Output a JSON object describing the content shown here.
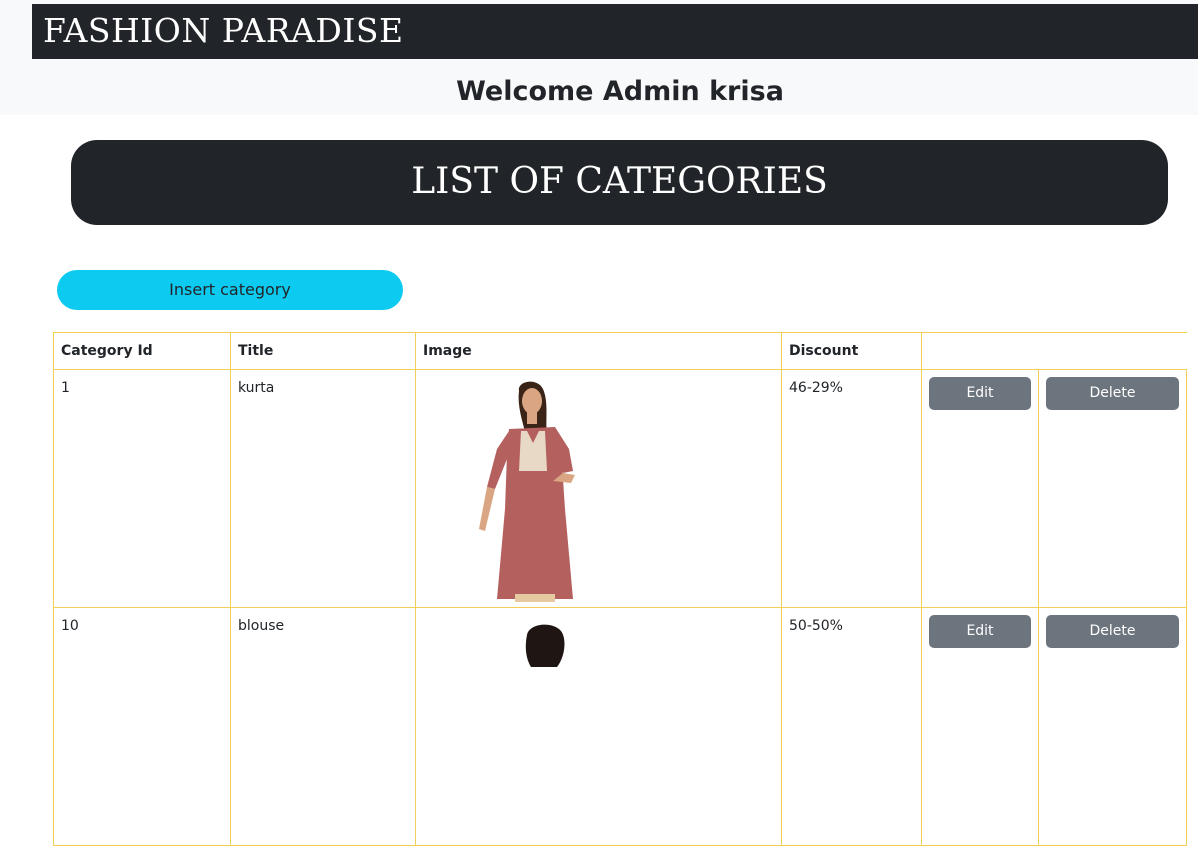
{
  "brand": "FASHION PARADISE",
  "welcome": "Welcome Admin krisa",
  "page_title": "LIST OF CATEGORIES",
  "insert_button": "Insert category",
  "table": {
    "headers": [
      "Category Id",
      "Title",
      "Image",
      "Discount"
    ],
    "rows": [
      {
        "id": "1",
        "title": "kurta",
        "discount": "46-29%",
        "edit": "Edit",
        "delete": "Delete"
      },
      {
        "id": "10",
        "title": "blouse",
        "discount": "50-50%",
        "edit": "Edit",
        "delete": "Delete"
      }
    ]
  },
  "colors": {
    "dark": "#212529",
    "accent": "#0dcaf0",
    "secondary": "#6c757d",
    "table_border": "#f2d058"
  }
}
